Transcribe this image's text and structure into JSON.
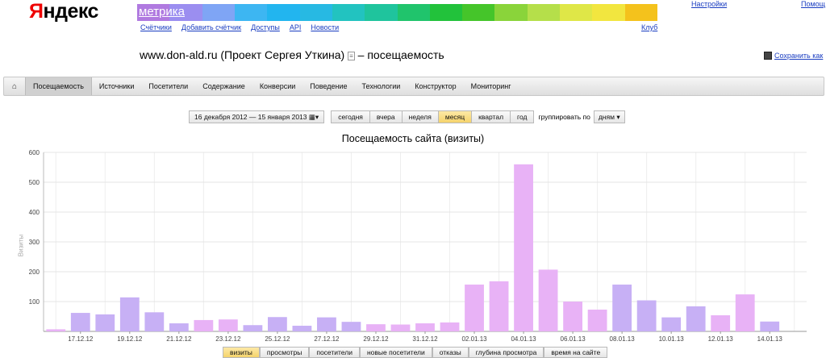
{
  "header": {
    "logo_first": "Я",
    "logo_rest": "ндекс",
    "product": "метрика",
    "nav": [
      "Счётчики",
      "Добавить счётчик",
      "Доступы",
      "API",
      "Новости"
    ],
    "club": "Клуб",
    "settings": "Настройки",
    "help": "Помощ",
    "rainbow": [
      "#b07ae0",
      "#9b8ef0",
      "#7fa5f5",
      "#3db6f2",
      "#22b5ef",
      "#27b9e3",
      "#22c3c0",
      "#1fc49d",
      "#20c46c",
      "#22c23b",
      "#45c52a",
      "#8ad43a",
      "#b5df4a",
      "#dfe747",
      "#f2e63f",
      "#f4c21c"
    ]
  },
  "page": {
    "title_prefix": "www.don-ald.ru (Проект Сергея Уткина)",
    "title_suffix": "– посещаемость",
    "save": "Сохранить как"
  },
  "menu": {
    "tabs": [
      "Посещаемость",
      "Источники",
      "Посетители",
      "Содержание",
      "Конверсии",
      "Поведение",
      "Технологии",
      "Конструктор",
      "Мониторинг"
    ],
    "active": 0
  },
  "controls": {
    "date_range": "16 декабря 2012 — 15 января 2013",
    "periods": [
      "сегодня",
      "вчера",
      "неделя",
      "месяц",
      "квартал",
      "год"
    ],
    "active_period": "месяц",
    "group_label": "группировать по",
    "group_value": "дням"
  },
  "chart_data": {
    "type": "bar",
    "title": "Посещаемость сайта (визиты)",
    "ylabel": "Визиты",
    "ylim": [
      0,
      600
    ],
    "yticks": [
      100,
      200,
      300,
      400,
      500,
      600
    ],
    "x_tick_labels": [
      "17.12.12",
      "19.12.12",
      "21.12.12",
      "23.12.12",
      "25.12.12",
      "27.12.12",
      "29.12.12",
      "31.12.12",
      "02.01.13",
      "04.01.13",
      "06.01.13",
      "08.01.13",
      "10.01.13",
      "12.01.13",
      "14.01.13"
    ],
    "categories": [
      "16.12.12",
      "17.12.12",
      "18.12.12",
      "19.12.12",
      "20.12.12",
      "21.12.12",
      "22.12.12",
      "23.12.12",
      "24.12.12",
      "25.12.12",
      "26.12.12",
      "27.12.12",
      "28.12.12",
      "29.12.12",
      "30.12.12",
      "31.12.12",
      "01.01.13",
      "02.01.13",
      "03.01.13",
      "04.01.13",
      "05.01.13",
      "06.01.13",
      "07.01.13",
      "08.01.13",
      "09.01.13",
      "10.01.13",
      "11.01.13",
      "12.01.13",
      "13.01.13",
      "14.01.13",
      "15.01.13"
    ],
    "values": [
      7,
      62,
      57,
      114,
      64,
      27,
      38,
      40,
      21,
      48,
      19,
      47,
      32,
      24,
      23,
      27,
      30,
      157,
      168,
      560,
      207,
      100,
      73,
      157,
      104,
      47,
      84,
      54,
      124,
      33,
      0
    ],
    "colors": {
      "weekday": "#c7b0f5",
      "weekend": "#e8b2f6"
    },
    "weekend": [
      1,
      0,
      0,
      0,
      0,
      0,
      1,
      1,
      0,
      0,
      0,
      0,
      0,
      1,
      1,
      1,
      1,
      1,
      1,
      1,
      1,
      1,
      1,
      0,
      0,
      0,
      0,
      1,
      1,
      0,
      0
    ]
  },
  "bottom_tabs": {
    "items": [
      "визиты",
      "просмотры",
      "посетители",
      "новые посетители",
      "отказы",
      "глубина просмотра",
      "время на сайте"
    ],
    "active": 0
  }
}
